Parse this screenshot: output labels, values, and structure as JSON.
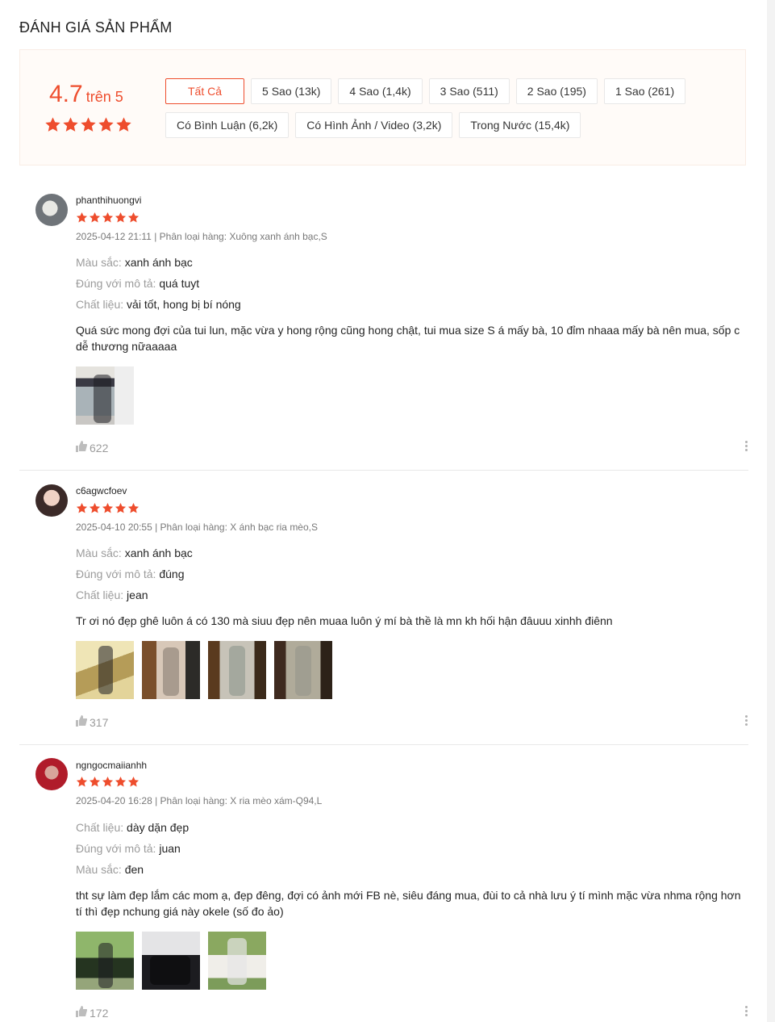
{
  "title": "ĐÁNH GIÁ SẢN PHẨM",
  "overview": {
    "rating": "4.7",
    "rating_suffix": "trên 5",
    "stars": 5
  },
  "filters": {
    "row1": [
      "Tất Cả",
      "5 Sao (13k)",
      "4 Sao (1,4k)",
      "3 Sao (511)",
      "2 Sao (195)",
      "1 Sao (261)"
    ],
    "row2": [
      "Có Bình Luận (6,2k)",
      "Có Hình Ảnh / Video (3,2k)",
      "Trong Nước (15,4k)"
    ],
    "active_index": 0
  },
  "colors": {
    "accent": "#ee4d2d",
    "star": "#ee4d2d",
    "muted": "#9e9e9e"
  },
  "icons": {
    "like": "thumbs-up-icon",
    "more": "more-vertical-icon",
    "star": "star-icon"
  },
  "reviews": [
    {
      "author": "phanthihuongvi",
      "stars": 5,
      "meta": "2025-04-12 21:11 | Phân loại hàng: Xuông xanh ánh bạc,S",
      "attrs": [
        {
          "k": "Màu sắc:",
          "v": "xanh ánh bạc"
        },
        {
          "k": "Đúng với mô tả:",
          "v": "quá tuyt"
        },
        {
          "k": "Chất liệu:",
          "v": "vải tốt, hong bị bí nóng"
        }
      ],
      "comment": "Quá sức mong đợi của tui lun, mặc vừa y hong rộng cũng hong chật, tui mua size S á mấy bà, 10 đỉm nhaaa mấy bà nên mua, sốp c dễ thương nữaaaaa",
      "likes": "622"
    },
    {
      "author": "c6agwcfoev",
      "stars": 5,
      "meta": "2025-04-10 20:55 | Phân loại hàng: X ánh bạc ria mèo,S",
      "attrs": [
        {
          "k": "Màu sắc:",
          "v": "xanh ánh bạc"
        },
        {
          "k": "Đúng với mô tả:",
          "v": "đúng"
        },
        {
          "k": "Chất liệu:",
          "v": "jean"
        }
      ],
      "comment": "Tr ơi nó đẹp ghê luôn á có 130 mà siuu đẹp nên muaa luôn ý mí bà thề là mn kh hối hận đâuuu xinhh điênn",
      "likes": "317"
    },
    {
      "author": "ngngocmaiianhh",
      "stars": 5,
      "meta": "2025-04-20 16:28 | Phân loại hàng: X ria mèo xám-Q94,L",
      "attrs": [
        {
          "k": "Chất liệu:",
          "v": "dày dặn đẹp"
        },
        {
          "k": "Đúng với mô tả:",
          "v": "juan"
        },
        {
          "k": "Màu sắc:",
          "v": "đen"
        }
      ],
      "comment": "tht sự làm đẹp lắm các mom ạ, đẹp đêng, đợi có ảnh mới FB nè, siêu đáng mua, đùi to cả nhà lưu ý tí mình mặc vừa nhma rộng hơn tí thì đẹp nchung giá này okele (số đo ảo)",
      "likes": "172"
    }
  ]
}
